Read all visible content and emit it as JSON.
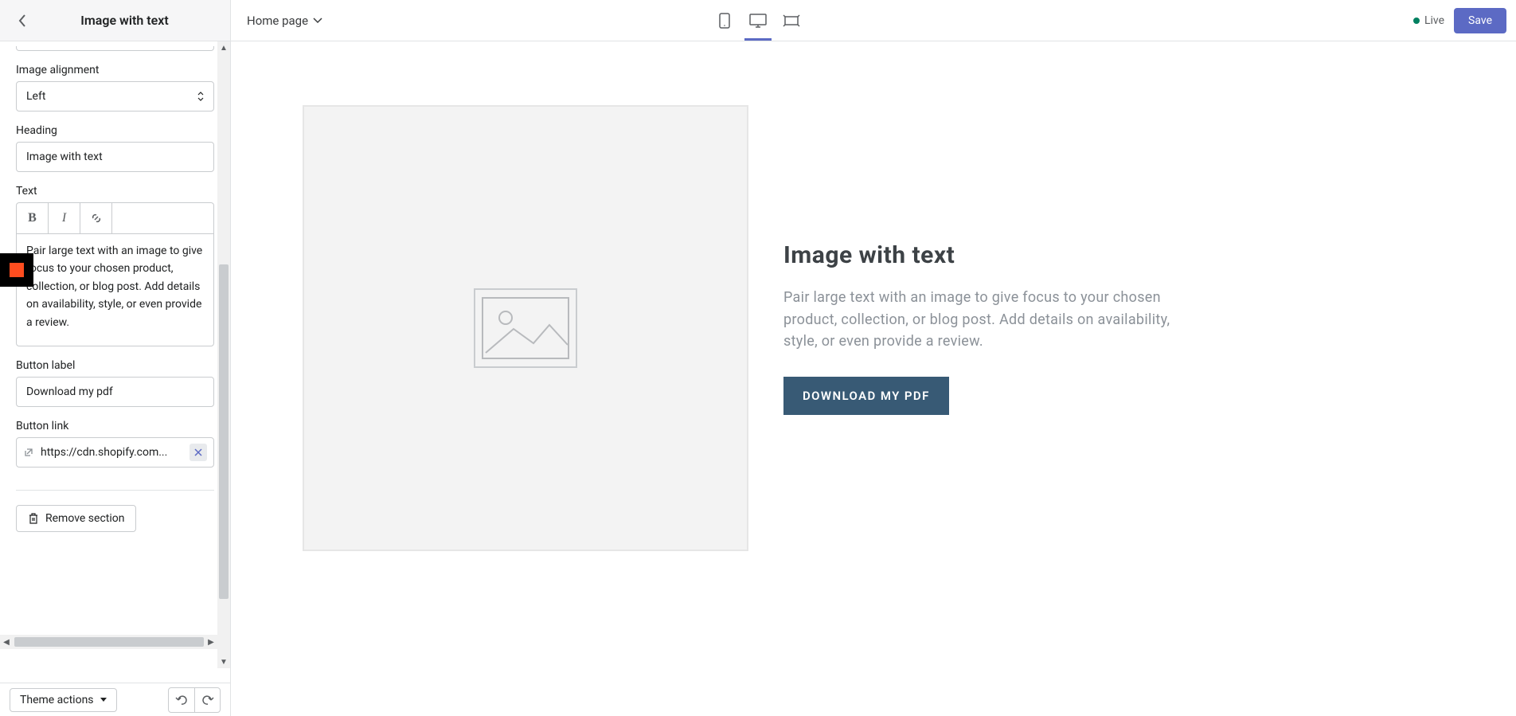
{
  "topbar": {
    "title": "Image with text",
    "page_selector": "Home page",
    "live_label": "Live",
    "save_label": "Save"
  },
  "sidebar": {
    "image_alignment": {
      "label": "Image alignment",
      "value": "Left"
    },
    "heading": {
      "label": "Heading",
      "value": "Image with text"
    },
    "text": {
      "label": "Text",
      "value": "Pair large text with an image to give focus to your chosen product, collection, or blog post. Add details on availability, style, or even provide a review."
    },
    "button_label": {
      "label": "Button label",
      "value": "Download my pdf"
    },
    "button_link": {
      "label": "Button link",
      "value": "https://cdn.shopify.com..."
    },
    "remove_section": "Remove section",
    "theme_actions": "Theme actions"
  },
  "preview": {
    "heading": "Image with text",
    "body": "Pair large text with an image to give focus to your chosen product, collection, or blog post. Add details on availability, style, or even provide a review.",
    "button": "DOWNLOAD MY PDF"
  }
}
